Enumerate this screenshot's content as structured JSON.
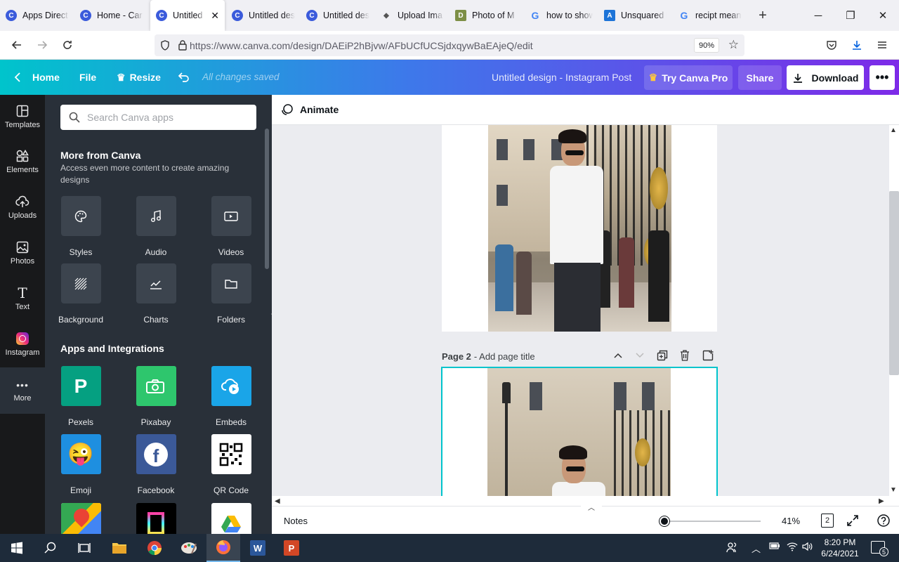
{
  "browser": {
    "tabs": [
      {
        "label": "Apps Direct",
        "icon": "canva-favicon",
        "active": false
      },
      {
        "label": "Home - Car",
        "icon": "canva-favicon",
        "active": false
      },
      {
        "label": "Untitled d",
        "icon": "canva-favicon",
        "active": true
      },
      {
        "label": "Untitled des",
        "icon": "canva-favicon",
        "active": false
      },
      {
        "label": "Untitled des",
        "icon": "canva-favicon",
        "active": false
      },
      {
        "label": "Upload Ima",
        "icon": "upload-favicon",
        "active": false
      },
      {
        "label": "Photo of M",
        "icon": "d-favicon",
        "active": false
      },
      {
        "label": "how to show",
        "icon": "google-favicon",
        "active": false
      },
      {
        "label": "Unsquared I",
        "icon": "unsquared-favicon",
        "active": false
      },
      {
        "label": "recipt mean",
        "icon": "google-favicon",
        "active": false
      }
    ],
    "url": "https://www.canva.com/design/DAEiP2hBjvw/AFbUCfUCSjdxqywBaEAjeQ/edit",
    "zoom": "90%"
  },
  "header": {
    "home": "Home",
    "file": "File",
    "resize": "Resize",
    "saved_status": "All changes saved",
    "doc_title": "Untitled design - Instagram Post",
    "try_pro": "Try Canva Pro",
    "share": "Share",
    "download": "Download",
    "gradient_colors": [
      "#00c4cc",
      "#3d79ea",
      "#7d2ae8"
    ]
  },
  "rail": [
    {
      "label": "Templates",
      "icon": "templates-icon"
    },
    {
      "label": "Elements",
      "icon": "elements-icon"
    },
    {
      "label": "Uploads",
      "icon": "uploads-icon"
    },
    {
      "label": "Photos",
      "icon": "photos-icon"
    },
    {
      "label": "Text",
      "icon": "text-icon"
    },
    {
      "label": "Instagram",
      "icon": "instagram-icon"
    },
    {
      "label": "More",
      "icon": "more-icon",
      "active": true
    }
  ],
  "panel": {
    "search_placeholder": "Search Canva apps",
    "more_title": "More from Canva",
    "more_subtitle": "Access even more content to create amazing designs",
    "more_items": [
      "Styles",
      "Audio",
      "Videos",
      "Background",
      "Charts",
      "Folders"
    ],
    "apps_title": "Apps and Integrations",
    "apps": [
      {
        "label": "Pexels",
        "color": "#05a081"
      },
      {
        "label": "Pixabay",
        "color": "#2ec66d"
      },
      {
        "label": "Embeds",
        "color": "#1aa5e8"
      },
      {
        "label": "Emoji",
        "color": "#1e8fe0"
      },
      {
        "label": "Facebook",
        "color": "#3b5998"
      },
      {
        "label": "QR Code",
        "color": "#ffffff"
      },
      {
        "label": "Google Maps",
        "color": "#ffffff"
      },
      {
        "label": "Bitmoji",
        "color": "#000000"
      },
      {
        "label": "Google Drive",
        "color": "#ffffff"
      }
    ]
  },
  "toolbar": {
    "animate": "Animate"
  },
  "canvas": {
    "page2_label": "Page 2",
    "page2_title_placeholder": "- Add page title"
  },
  "bottom": {
    "notes": "Notes",
    "zoom": "41%",
    "zoom_fraction": 0.04,
    "page_count": "2"
  },
  "taskbar": {
    "time": "8:20 PM",
    "date": "6/24/2021",
    "notifications": "5"
  }
}
